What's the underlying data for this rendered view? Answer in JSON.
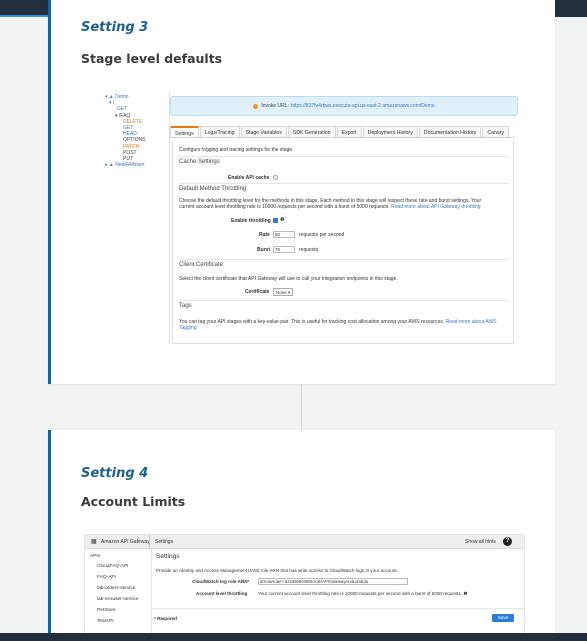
{
  "card1": {
    "label": "Setting 3",
    "title": "Stage level defaults",
    "screenshot": {
      "tree": [
        {
          "text": "▾ ▲ Demo",
          "color": "blue",
          "indent": 2
        },
        {
          "text": "▾ /",
          "color": "blue",
          "indent": 6
        },
        {
          "text": "GET",
          "color": "blue",
          "indent": 14
        },
        {
          "text": "▾ /FAQ",
          "color": "dark",
          "indent": 12
        },
        {
          "text": "DELETE",
          "color": "orange",
          "indent": 20
        },
        {
          "text": "GET",
          "color": "blue",
          "indent": 20
        },
        {
          "text": "HEAD",
          "color": "blue",
          "indent": 20
        },
        {
          "text": "OPTIONS",
          "color": "dark",
          "indent": 20
        },
        {
          "text": "PATCH",
          "color": "orange",
          "indent": 20
        },
        {
          "text": "POST",
          "color": "dark",
          "indent": 20
        },
        {
          "text": "PUT",
          "color": "dark",
          "indent": 20
        },
        {
          "text": "▸ ▲ NewFAAnum",
          "color": "blue",
          "indent": 2
        }
      ],
      "invoke_label": "Invoke URL:",
      "invoke_url": "https://837fv4rbws.execute-api.us-east-2.amazonaws.com/Demo",
      "tabs": [
        "Settings",
        "Logs/Tracing",
        "Stage Variables",
        "SDK Generation",
        "Export",
        "Deployment History",
        "Documentation History",
        "Canary"
      ],
      "intro": "Configure logging and tracing settings for the stage.",
      "cache_heading": "Cache Settings",
      "enable_cache_label": "Enable API cache",
      "throttle_heading": "Default Method Throttling",
      "throttle_text_1": "Choose the default throttling level for the methods in this stage. Each method in this stage will respect these rate and burst settings. Your",
      "throttle_text_2": "current account level throttling rate is 10000 requests per second with a burst of 5000 requests.",
      "throttle_link": "Read more about API Gateway throttling",
      "enable_throttling_label": "Enable throttling",
      "rate_label": "Rate",
      "rate_value": "50",
      "rate_unit": "requests per second",
      "burst_label": "Burst",
      "burst_value": "75",
      "burst_unit": "requests",
      "cert_heading": "Client Certificate",
      "cert_text": "Select the client certificate that API Gateway will use to call your integration endpoints in this stage.",
      "cert_label": "Certificate",
      "cert_value": "None",
      "tags_heading": "Tags",
      "tags_text": "You can tag your API stages with a key-value pair. This is useful for tracking cost allocation among your AWS resources.",
      "tags_link": "Read more about AWS",
      "tags_link_2": "Tagging"
    }
  },
  "card2": {
    "label": "Setting 4",
    "title": "Account Limits",
    "screenshot": {
      "service_name": "Amazon API Gateway",
      "header_settings": "Settings",
      "header_right": "Show all hints",
      "help": "?",
      "side_heading": "APIs",
      "side_items": [
        "CloudFAQ-API",
        "FAQ-API",
        "lab-orders-service",
        "lab-ecsuser-service",
        "PetStore",
        "TestAPI"
      ],
      "page_title": "Settings",
      "intro": "Provide an Identity and Access Management (IAM) role ARN that has write access to CloudWatch logs in your account.",
      "role_label": "CloudWatch log role ARN*",
      "role_value": "arn:aws:iam::623456803085:role/APIGatewayAndLambda",
      "limit_label": "Account level throttling",
      "limit_text": "Your current account level throttling rate is 10000 requests per second with a burst of 5000 requests.",
      "required_note": "* Required",
      "save_label": "Save"
    }
  },
  "colors": {
    "accent": "#1f5f8b",
    "topbar": "#232f3e",
    "progress": "#3f8fd7"
  }
}
